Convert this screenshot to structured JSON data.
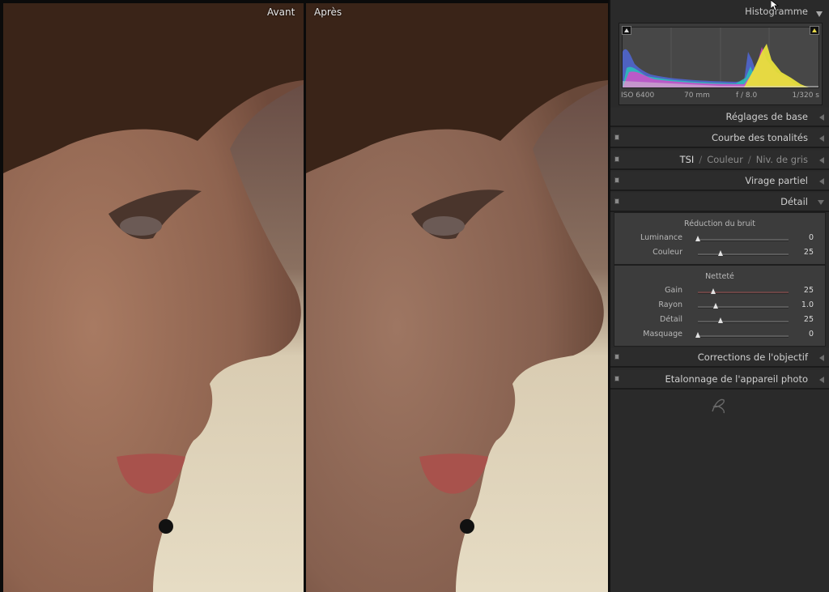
{
  "viewer": {
    "before_label": "Avant",
    "after_label": "Après"
  },
  "panel": {
    "histogram": {
      "title": "Histogramme",
      "iso": "ISO 6400",
      "focal": "70 mm",
      "aperture": "f / 8.0",
      "shutter": "1/320 s"
    },
    "sections": {
      "basic": "Réglages de base",
      "tone_curve": "Courbe des tonalités",
      "tsi": "TSI",
      "color": "Couleur",
      "gray": "Niv. de gris",
      "split_toning": "Virage partiel",
      "detail": "Détail",
      "lens": "Corrections de l'objectif",
      "camera": "Etalonnage de l'appareil photo"
    },
    "detail": {
      "noise_title": "Réduction du bruit",
      "noise": [
        {
          "label": "Luminance",
          "value": "0",
          "level": 0.0
        },
        {
          "label": "Couleur",
          "value": "25",
          "level": 0.25
        }
      ],
      "sharpen_title": "Netteté",
      "sharpen": [
        {
          "label": "Gain",
          "value": "25",
          "level": 0.17
        },
        {
          "label": "Rayon",
          "value": "1.0",
          "level": 0.2
        },
        {
          "label": "Détail",
          "value": "25",
          "level": 0.25
        },
        {
          "label": "Masquage",
          "value": "0",
          "level": 0.0
        }
      ]
    }
  },
  "colors": {
    "panel_bg": "#2a2a2a",
    "skin": "#9a6e58",
    "hair": "#3a2418",
    "background_light": "#e2d6bd"
  }
}
